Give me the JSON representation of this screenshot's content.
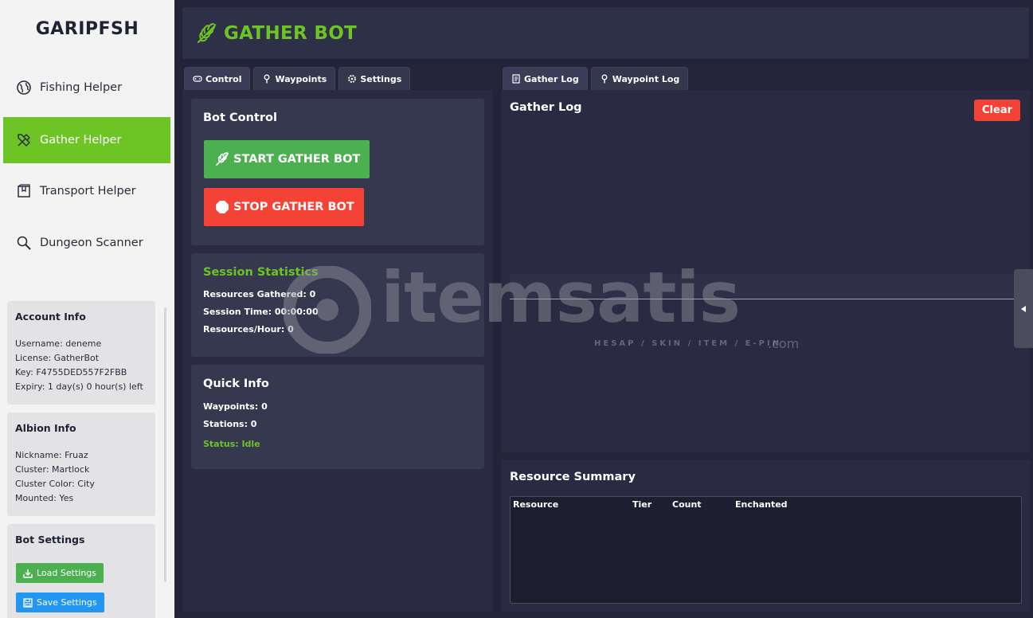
{
  "sidebar": {
    "brand": "GARIPFSH",
    "nav": [
      {
        "label": "Fishing Helper",
        "icon": "globe-icon"
      },
      {
        "label": "Gather Helper",
        "icon": "tools-icon",
        "active": true
      },
      {
        "label": "Transport Helper",
        "icon": "box-icon"
      },
      {
        "label": "Dungeon Scanner",
        "icon": "magnifier-icon"
      }
    ],
    "account": {
      "title": "Account Info",
      "username": "Username: deneme",
      "license": "License: GatherBot",
      "key": "Key: F4755DED557F2FBB",
      "expiry": "Expiry: 1 day(s) 0 hour(s) left"
    },
    "albion": {
      "title": "Albion Info",
      "nickname": "Nickname: Fruaz",
      "cluster": "Cluster: Martlock",
      "cluster_color": "Cluster Color: City",
      "mounted": "Mounted: Yes"
    },
    "bot_settings": {
      "title": "Bot Settings",
      "load_label": "Load Settings",
      "save_label": "Save Settings"
    }
  },
  "header": {
    "title": "GATHER BOT",
    "accent": "#6cc425"
  },
  "left_tabs": {
    "control": "Control",
    "waypoints": "Waypoints",
    "settings": "Settings"
  },
  "right_tabs": {
    "gather_log": "Gather Log",
    "waypoint_log": "Waypoint Log"
  },
  "bot_control": {
    "title": "Bot Control",
    "start_label": "START GATHER BOT",
    "stop_label": "STOP GATHER BOT"
  },
  "session": {
    "title": "Session Statistics",
    "resources_gathered": "Resources Gathered: 0",
    "session_time": "Session Time: 00:00:00",
    "resources_per_hour": "Resources/Hour: 0"
  },
  "quick_info": {
    "title": "Quick Info",
    "waypoints": "Waypoints: 0",
    "stations": "Stations: 0",
    "status": "Status: Idle"
  },
  "gather_log": {
    "title": "Gather Log",
    "clear_label": "Clear"
  },
  "resource_summary": {
    "title": "Resource Summary",
    "columns": [
      "Resource",
      "Tier",
      "Count",
      "Enchanted"
    ]
  },
  "watermark": {
    "text": "itemsatis",
    "sub": "HESAP / SKIN / ITEM / E-PIN",
    "suffix": ".com"
  },
  "colors": {
    "green": "#6cc425",
    "red": "#f44336",
    "blue": "#2196f3",
    "panel": "#36384f"
  }
}
